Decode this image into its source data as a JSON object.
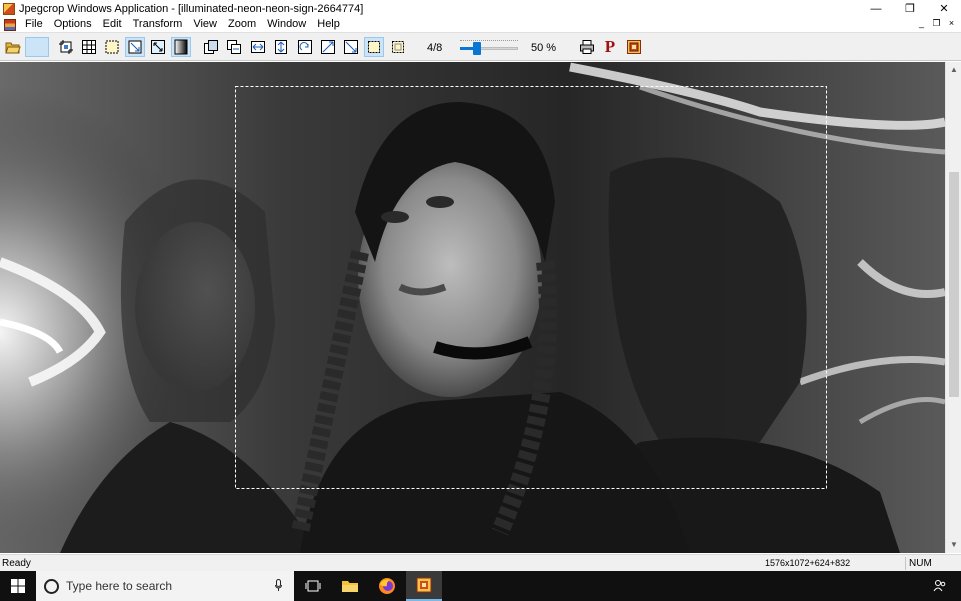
{
  "window": {
    "title": "Jpegcrop Windows Application - [illuminated-neon-neon-sign-2664774]",
    "controls": {
      "minimize": "—",
      "restore": "❐",
      "close": "✕"
    },
    "mdi_controls": {
      "minimize": "_",
      "restore": "❐",
      "close": "×"
    }
  },
  "menu": {
    "items": [
      "File",
      "Options",
      "Edit",
      "Transform",
      "View",
      "Zoom",
      "Window",
      "Help"
    ]
  },
  "toolbar": {
    "page_counter": "4/8",
    "zoom_label": "50 %",
    "zoom_level_fraction": 0.3,
    "print_letter": "P"
  },
  "status": {
    "ready": "Ready",
    "dims": "1576x1072+624+832",
    "num": "NUM"
  },
  "taskbar": {
    "search_placeholder": "Type here to search"
  },
  "colors": {
    "accent": "#0a76d4",
    "pressed": "#cce4f7",
    "taskbar": "#101010"
  }
}
